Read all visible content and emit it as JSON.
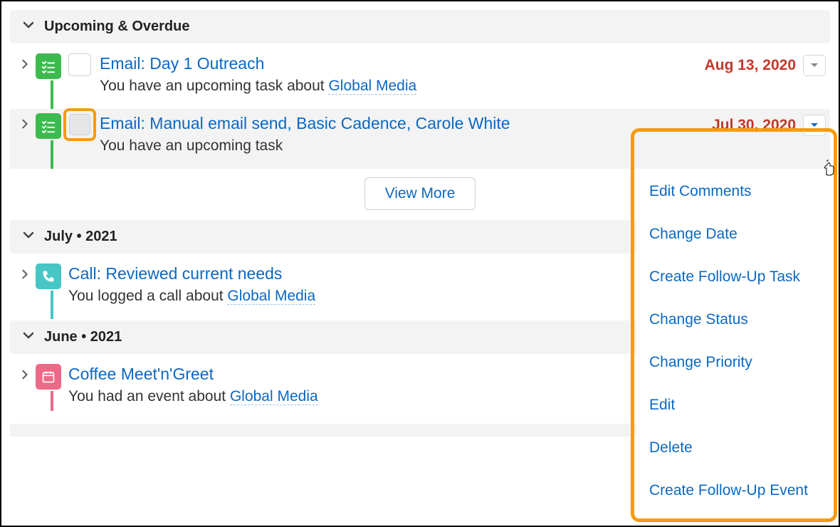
{
  "sections": {
    "upcoming": {
      "title": "Upcoming & Overdue"
    },
    "july": {
      "title": "July  •  2021"
    },
    "june": {
      "title": "June  •  2021"
    }
  },
  "tasks": [
    {
      "title": "Email: Day 1 Outreach",
      "desc_prefix": "You have an upcoming task about ",
      "link": "Global Media",
      "date": "Aug 13, 2020"
    },
    {
      "title": "Email: Manual email send, Basic Cadence, Carole White",
      "desc_prefix": "You have an upcoming task",
      "link": "",
      "date": "Jul 30, 2020"
    },
    {
      "title": "Call: Reviewed current needs",
      "desc_prefix": "You logged a call about ",
      "link": "Global Media",
      "date": ""
    },
    {
      "title": "Coffee Meet'n'Greet",
      "desc_prefix": "You had an event about ",
      "link": "Global Media",
      "date": ""
    }
  ],
  "view_more": "View More",
  "menu": [
    "Edit Comments",
    "Change Date",
    "Create Follow-Up Task",
    "Change Status",
    "Change Priority",
    "Edit",
    "Delete",
    "Create Follow-Up Event"
  ]
}
